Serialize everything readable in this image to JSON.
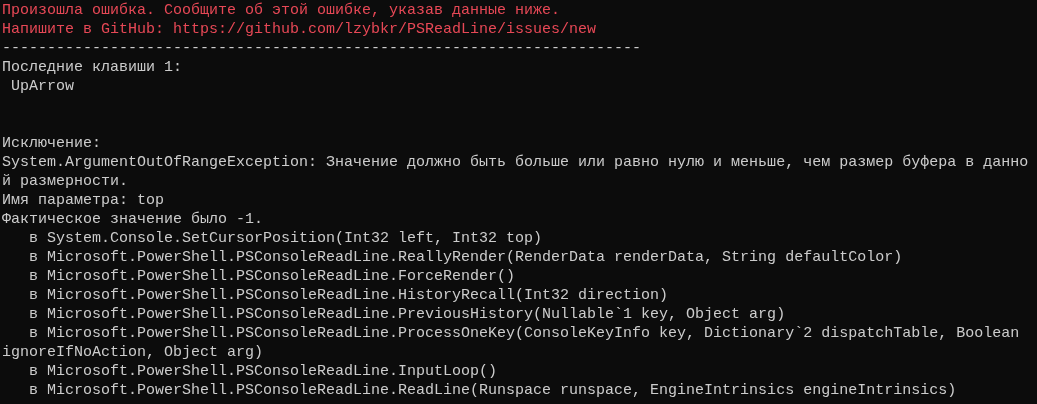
{
  "terminal": {
    "lines": [
      {
        "kind": "error",
        "text": "Произошла ошибка. Сообщите об этой ошибке, указав данные ниже."
      },
      {
        "kind": "error",
        "text": "Напишите в GitHub: https://github.com/lzybkr/PSReadLine/issues/new"
      },
      {
        "kind": "output",
        "text": "-----------------------------------------------------------------------"
      },
      {
        "kind": "output",
        "text": "Последние клавиши 1:"
      },
      {
        "kind": "output",
        "text": " UpArrow"
      },
      {
        "kind": "blank"
      },
      {
        "kind": "blank"
      },
      {
        "kind": "output",
        "text": "Исключение:"
      },
      {
        "kind": "output",
        "text": "System.ArgumentOutOfRangeException: Значение должно быть больше или равно нулю и меньше, чем размер буфера в данно"
      },
      {
        "kind": "output",
        "text": "й размерности."
      },
      {
        "kind": "output",
        "text": "Имя параметра: top"
      },
      {
        "kind": "output",
        "text": "Фактическое значение было -1."
      },
      {
        "kind": "output",
        "text": "   в System.Console.SetCursorPosition(Int32 left, Int32 top)"
      },
      {
        "kind": "output",
        "text": "   в Microsoft.PowerShell.PSConsoleReadLine.ReallyRender(RenderData renderData, String defaultColor)"
      },
      {
        "kind": "output",
        "text": "   в Microsoft.PowerShell.PSConsoleReadLine.ForceRender()"
      },
      {
        "kind": "output",
        "text": "   в Microsoft.PowerShell.PSConsoleReadLine.HistoryRecall(Int32 direction)"
      },
      {
        "kind": "output",
        "text": "   в Microsoft.PowerShell.PSConsoleReadLine.PreviousHistory(Nullable`1 key, Object arg)"
      },
      {
        "kind": "output",
        "text": "   в Microsoft.PowerShell.PSConsoleReadLine.ProcessOneKey(ConsoleKeyInfo key, Dictionary`2 dispatchTable, Boolean"
      },
      {
        "kind": "output",
        "text": "ignoreIfNoAction, Object arg)"
      },
      {
        "kind": "output",
        "text": "   в Microsoft.PowerShell.PSConsoleReadLine.InputLoop()"
      },
      {
        "kind": "output",
        "text": "   в Microsoft.PowerShell.PSConsoleReadLine.ReadLine(Runspace runspace, EngineIntrinsics engineIntrinsics)"
      }
    ]
  }
}
